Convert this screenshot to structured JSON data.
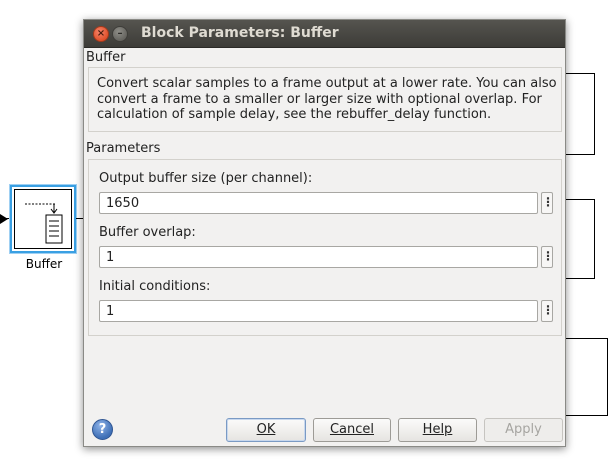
{
  "canvas": {
    "block_label": "Buffer"
  },
  "dialog": {
    "title": "Block Parameters: Buffer",
    "block_type": "Buffer",
    "description": "Convert scalar samples to a frame output at a lower rate. You can also convert a frame to a smaller or larger size with optional overlap. For calculation of sample delay, see the rebuffer_delay function.",
    "parameters_heading": "Parameters",
    "fields": [
      {
        "label": "Output buffer size (per channel):",
        "value": "1650"
      },
      {
        "label": "Buffer overlap:",
        "value": "1"
      },
      {
        "label": "Initial conditions:",
        "value": "1"
      }
    ],
    "more_button_glyph": "⋮",
    "buttons": {
      "ok": "OK",
      "cancel": "Cancel",
      "help": "Help",
      "apply": "Apply"
    },
    "help_icon_glyph": "?",
    "window_controls": {
      "close_glyph": "×",
      "minimize_glyph": "–"
    }
  },
  "colors": {
    "titlebar": "#3d3c38",
    "dialog_bg": "#f2f1f0",
    "block_highlight": "#3aa0e3",
    "close_button": "#e0512c"
  }
}
